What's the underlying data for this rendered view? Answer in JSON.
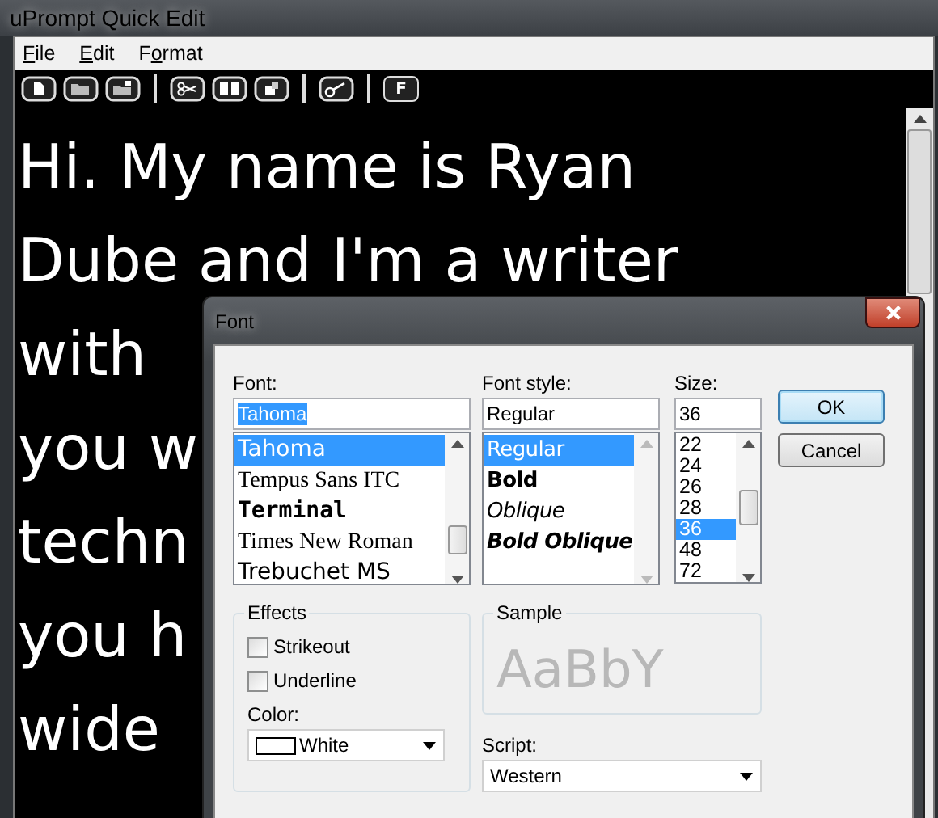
{
  "window": {
    "title": "uPrompt Quick Edit"
  },
  "menu": [
    {
      "key": "F",
      "post": "ile"
    },
    {
      "key": "E",
      "post": "dit"
    },
    {
      "pre": "F",
      "key": "o",
      "post": "rmat"
    }
  ],
  "toolbar": [
    {
      "kind": "document"
    },
    {
      "kind": "folder"
    },
    {
      "kind": "folder-save"
    },
    {
      "kind": "separator"
    },
    {
      "kind": "scissors"
    },
    {
      "kind": "book"
    },
    {
      "kind": "clipboard"
    },
    {
      "kind": "separator"
    },
    {
      "kind": "key"
    },
    {
      "kind": "separator"
    },
    {
      "kind": "letter",
      "label": "F"
    }
  ],
  "editor": {
    "lines": [
      "Hi. My name is Ryan",
      "Dube and I'm a writer",
      "with",
      "you w",
      "techn",
      "you h",
      "wide"
    ]
  },
  "font_dialog": {
    "title": "Font",
    "font": {
      "label": "Font:",
      "value": "Tahoma",
      "items": [
        {
          "label": "Tahoma",
          "kind": "sans",
          "selected": true
        },
        {
          "label": "Tempus Sans ITC",
          "kind": "serif",
          "selected": false
        },
        {
          "label": "Terminal",
          "kind": "mono",
          "selected": false
        },
        {
          "label": "Times New Roman",
          "kind": "serif",
          "selected": false
        },
        {
          "label": "Trebuchet MS",
          "kind": "sans",
          "selected": false
        }
      ]
    },
    "style": {
      "label": "Font style:",
      "value": "Regular",
      "items": [
        {
          "label": "Regular",
          "kind": "regular",
          "selected": true
        },
        {
          "label": "Bold",
          "kind": "bold",
          "selected": false
        },
        {
          "label": "Oblique",
          "kind": "oblique",
          "selected": false
        },
        {
          "label": "Bold Oblique",
          "kind": "bold-oblique",
          "selected": false
        }
      ]
    },
    "size": {
      "label": "Size:",
      "value": "36",
      "items": [
        {
          "label": "22",
          "selected": false
        },
        {
          "label": "24",
          "selected": false
        },
        {
          "label": "26",
          "selected": false
        },
        {
          "label": "28",
          "selected": false
        },
        {
          "label": "36",
          "selected": true
        },
        {
          "label": "48",
          "selected": false
        },
        {
          "label": "72",
          "selected": false
        }
      ]
    },
    "buttons": [
      {
        "label": "OK",
        "default": true
      },
      {
        "label": "Cancel",
        "default": false
      }
    ],
    "effects": {
      "title": "Effects",
      "checkboxes": [
        {
          "label": "Strikeout",
          "checked": false
        },
        {
          "label": "Underline",
          "checked": false
        }
      ],
      "color_label": "Color:",
      "color_value": "White"
    },
    "sample": {
      "title": "Sample",
      "text": "AaBbY"
    },
    "script": {
      "label": "Script:",
      "value": "Western"
    }
  }
}
